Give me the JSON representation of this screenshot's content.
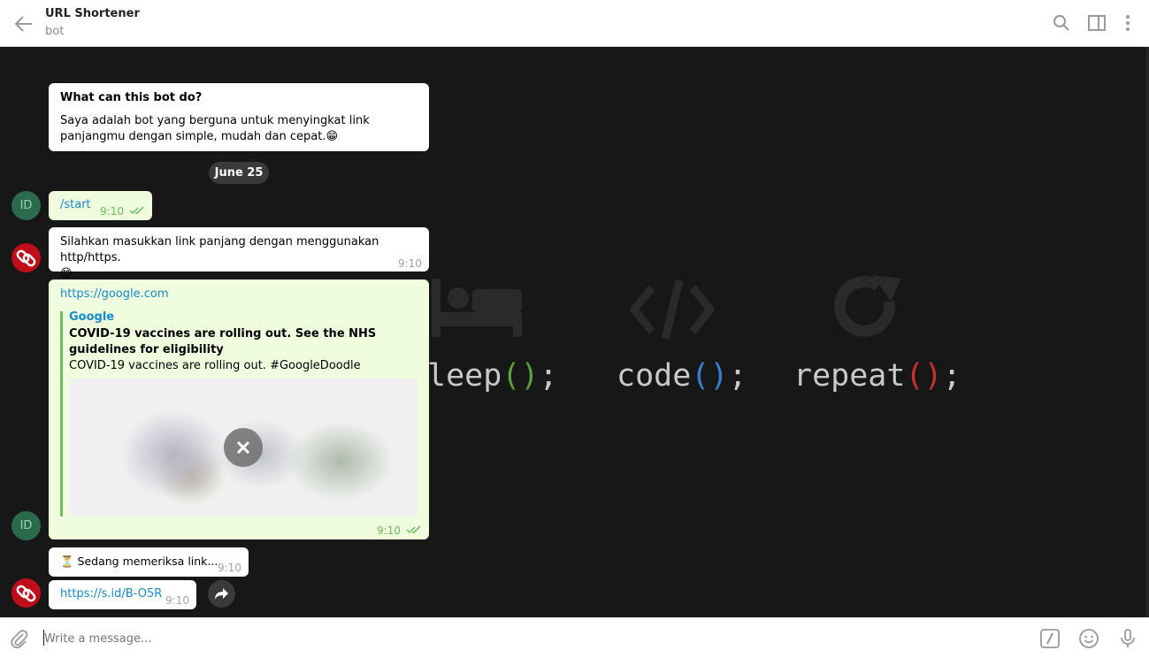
{
  "header": {
    "title": "URL Shortener",
    "subtitle": "bot"
  },
  "wallpaper": {
    "words": [
      "leep",
      "code",
      "repeat"
    ],
    "suffix": "();"
  },
  "intro": {
    "title": "What can this bot do?",
    "body": "Saya adalah bot yang berguna untuk menyingkat link panjangmu dengan simple, mudah dan cepat.😁"
  },
  "date_pill": "June 25",
  "messages": [
    {
      "text": "/start",
      "time": "9:10"
    },
    {
      "text": "Silahkan masukkan link panjang dengan menggunakan http/https.",
      "emoji": "😊",
      "time": "9:10"
    },
    {
      "link": "https://google.com",
      "time": "9:10",
      "preview": {
        "site": "Google",
        "title": "COVID-19 vaccines are rolling out. See the NHS guidelines for eligibility",
        "desc": "COVID-19 vaccines are rolling out. #GoogleDoodle"
      }
    },
    {
      "text": "⏳ Sedang memeriksa link...",
      "time": "9:10"
    },
    {
      "link": "https://s.id/B-O5R",
      "time": "9:10"
    }
  ],
  "avatars": {
    "user": "ID"
  },
  "composer": {
    "placeholder": "Write a message..."
  },
  "icons": {
    "back": "arrow-left-icon",
    "search": "search-icon",
    "sidebar": "sidebar-toggle-icon",
    "more": "more-vertical-icon",
    "attach": "paperclip-icon",
    "commands": "slash-command-icon",
    "emoji": "emoji-icon",
    "mic": "microphone-icon",
    "share": "share-icon",
    "read": "double-check-icon"
  },
  "colors": {
    "chat_bg": "#171717",
    "out_bubble": "#effdde",
    "link": "#168acd",
    "check": "#6cbf5c",
    "bot_avatar": "#c00d1a",
    "user_avatar": "#2c6a4d"
  }
}
